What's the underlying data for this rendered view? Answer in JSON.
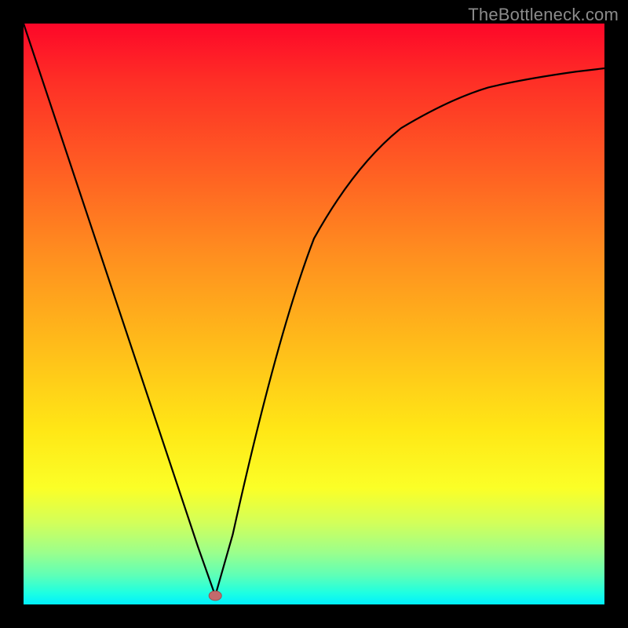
{
  "watermark": {
    "text": "TheBottleneck.com"
  },
  "colors": {
    "frame_bg": "#000000",
    "gradient_top": "#fd0729",
    "gradient_bottom": "#00f0ff",
    "curve": "#000000",
    "vertex_dot": "#c46a6c"
  },
  "chart_data": {
    "type": "line",
    "title": "",
    "xlabel": "",
    "ylabel": "",
    "xlim": [
      0,
      100
    ],
    "ylim": [
      0,
      100
    ],
    "grid": false,
    "legend": false,
    "background": "vertical-gradient red→green (bottleneck heatmap)",
    "annotations": [
      {
        "type": "dot",
        "x": 33,
        "y": 1.5,
        "label": "vertex"
      }
    ],
    "series": [
      {
        "name": "bottleneck-curve",
        "x": [
          0,
          5,
          10,
          15,
          20,
          25,
          30,
          33,
          36,
          40,
          45,
          50,
          55,
          60,
          65,
          70,
          75,
          80,
          85,
          90,
          95,
          100
        ],
        "values": [
          100,
          85,
          70,
          55,
          40,
          25,
          10,
          1.5,
          12,
          30,
          50,
          63,
          72,
          78,
          82,
          85,
          87.5,
          89,
          90.2,
          91,
          91.7,
          92.3
        ]
      }
    ]
  }
}
